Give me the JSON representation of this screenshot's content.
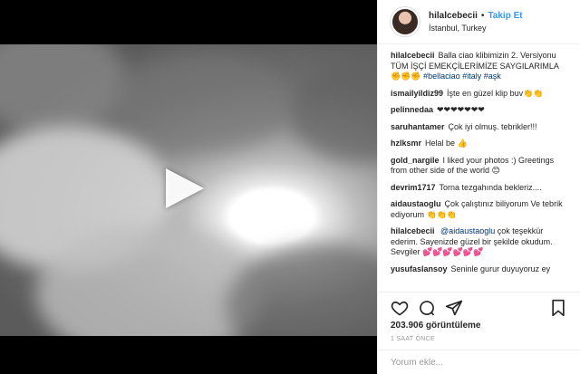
{
  "post": {
    "username": "hilalcebecii",
    "follow_label": "Takip Et",
    "separator": "•",
    "location": "İstanbul, Turkey"
  },
  "comments": [
    {
      "user": "hilalcebecii",
      "text": "Balla ciao klibimizin 2. Versiyonu TÜM İŞÇİ EMEKÇİLERİMİZE SAYGILARIMLA ✊✊✊",
      "tags": [
        "#bellaciao",
        "#italy",
        "#aşk"
      ]
    },
    {
      "user": "ismailyildiz99",
      "text": "İşte en güzel klip buv👏👏"
    },
    {
      "user": "pelinnedaa",
      "text": "❤❤❤❤❤❤❤"
    },
    {
      "user": "saruhantamer",
      "text": "Çok iyi olmuş. tebrikler!!!"
    },
    {
      "user": "hzlksmr",
      "text": "Helal be 👍"
    },
    {
      "user": "gold_nargile",
      "text": "I liked your photos :) Greetings from other side of the world 😊"
    },
    {
      "user": "devrim1717",
      "text": "Torna tezgahında bekleriz...."
    },
    {
      "user": "aidaustaoglu",
      "text": "Çok çalıştınız biliyorum Ve tebrik ediyorum 👏👏👏"
    },
    {
      "user": "hilalcebecii",
      "mention": "@aidaustaoglu",
      "text": "çok teşekkür ederim. Sayenizde güzel bir şekilde okudum. Sevgiler 💕💕💕💕💕💕"
    },
    {
      "user": "yusufaslansoy",
      "text": "Seninle gurur duyuyoruz ey"
    }
  ],
  "actions": {
    "views": "203.906 görüntüleme",
    "time_ago": "1 SAAT ÖNCE",
    "comment_placeholder": "Yorum ekle..."
  },
  "icons": {
    "like": "heart-icon",
    "comment": "comment-icon",
    "share": "share-icon",
    "save": "bookmark-icon",
    "play": "play-icon"
  }
}
